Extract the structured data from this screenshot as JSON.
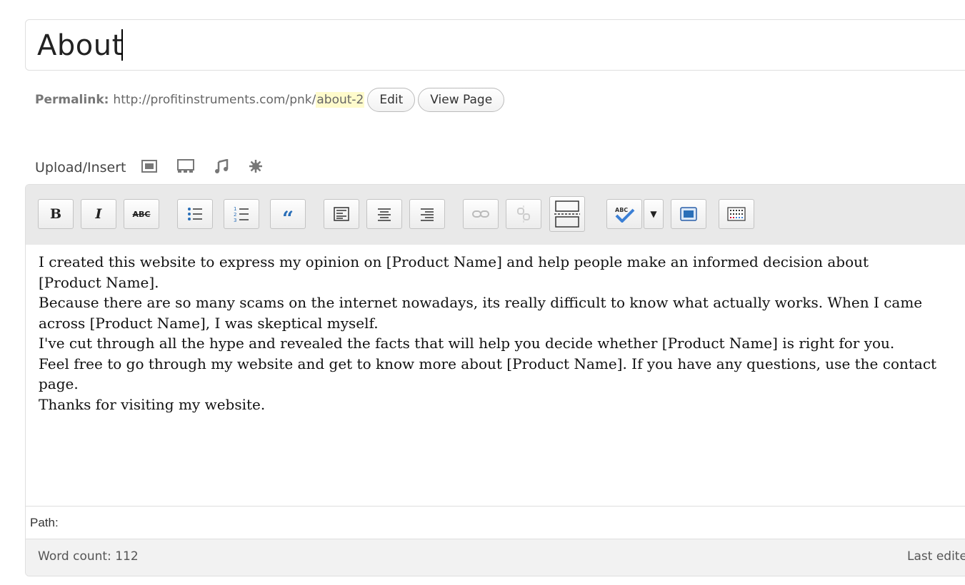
{
  "title": {
    "value": "About"
  },
  "permalink": {
    "label": "Permalink:",
    "base_url": "http://profitinstruments.com/pnk/",
    "slug": "about-2",
    "edit_label": "Edit",
    "view_label": "View Page"
  },
  "upload": {
    "label": "Upload/Insert",
    "icons": [
      "image-icon",
      "gallery-icon",
      "audio-icon",
      "media-icon"
    ]
  },
  "toolbar": {
    "bold": "B",
    "italic": "I",
    "strikethrough": "ABC",
    "blockquote": "“",
    "spellcheck_dropdown": "▼"
  },
  "content": {
    "lines": [
      "I created this website to express my opinion on [Product Name] and help people make an informed decision about",
      "[Product Name].",
      "Because there are so many scams on the internet nowadays, its really difficult to know what actually works. When I came",
      "across [Product Name], I was skeptical myself.",
      "I've cut through all the hype and revealed the facts that will help you decide whether [Product Name] is right for you.",
      "Feel free to go through my website and get to know more about [Product Name]. If you have any questions, use the contact",
      "page.",
      "Thanks for visiting my website."
    ]
  },
  "path": {
    "label": "Path:"
  },
  "status": {
    "word_count": "Word count: 112",
    "last_edited": "Last edited"
  }
}
